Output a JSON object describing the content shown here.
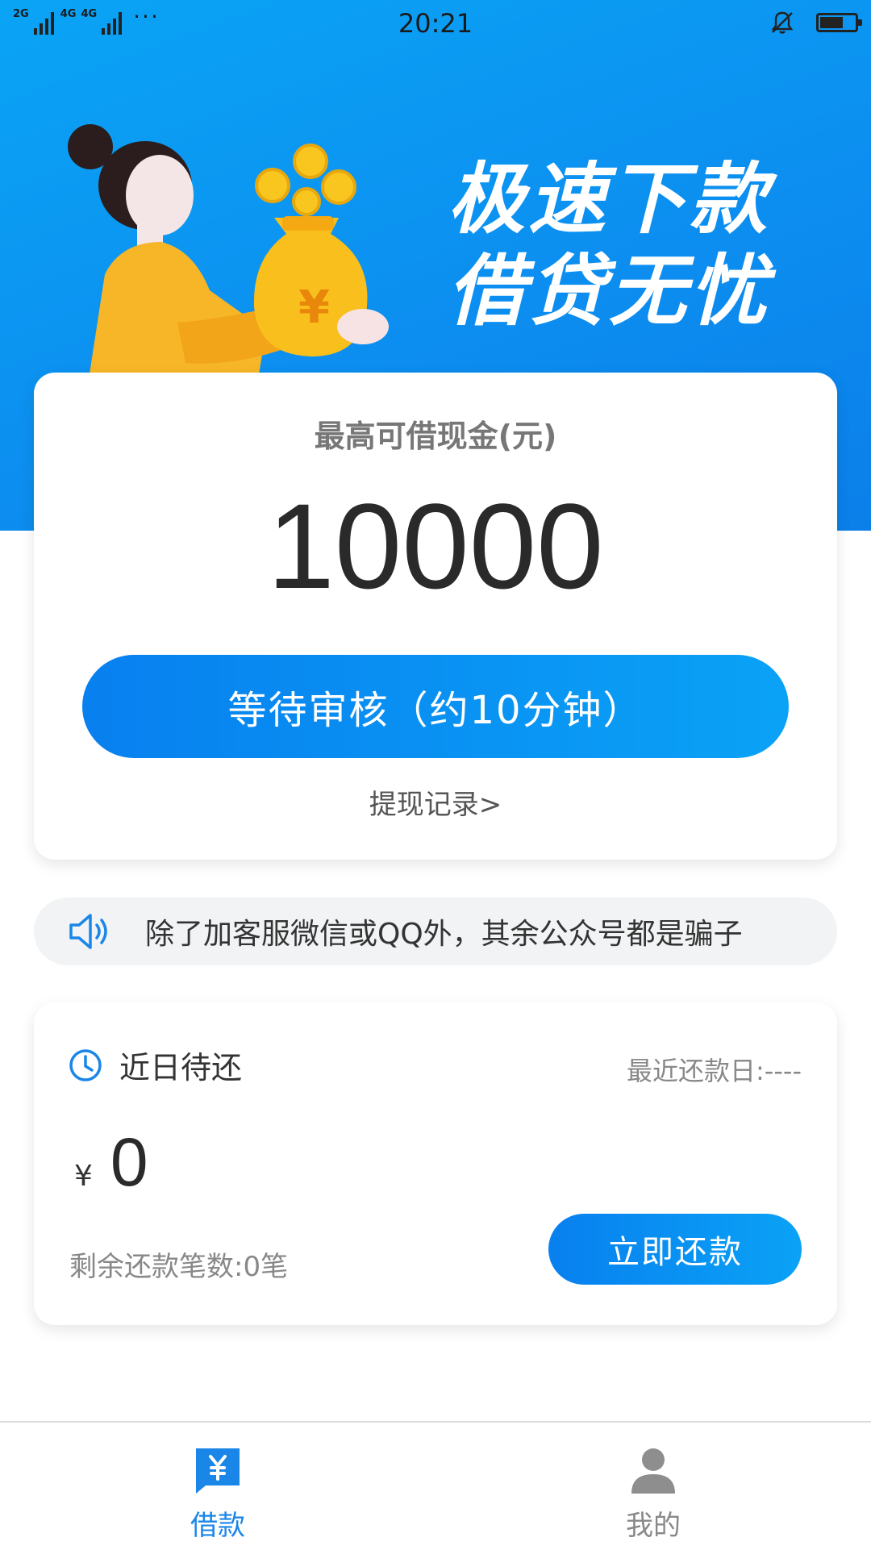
{
  "status_bar": {
    "network_1": "2G",
    "network_2": "4G",
    "network_3": "4G",
    "more": "···",
    "time": "20:21",
    "icons": [
      "bell-off-icon",
      "battery-icon"
    ],
    "battery_level": 0.6
  },
  "banner": {
    "title_line1": "极速下款",
    "title_line2": "借贷无忧",
    "illustration": "woman-with-money-bag",
    "money_symbol": "¥",
    "colors": {
      "start": "#0aa4f5",
      "end": "#0b7fe9"
    }
  },
  "loan_card": {
    "caption": "最高可借现金(元)",
    "amount": "10000",
    "status_button": "等待审核（约10分钟）",
    "records_link": "提现记录>"
  },
  "notice": {
    "icon": "speaker-icon",
    "text": "除了加客服微信或QQ外，其余公众号都是骗子"
  },
  "repay_card": {
    "icon": "clock-icon",
    "title": "近日待还",
    "recent_date": "最近还款日:----",
    "currency": "¥",
    "amount": "0",
    "remaining": "剩余还款笔数:0笔",
    "button": "立即还款"
  },
  "tab_bar": {
    "tabs": [
      {
        "label": "借款",
        "icon": "loan-yen-icon",
        "active": true
      },
      {
        "label": "我的",
        "icon": "user-icon",
        "active": false
      }
    ],
    "accent": "#1a86e8"
  }
}
